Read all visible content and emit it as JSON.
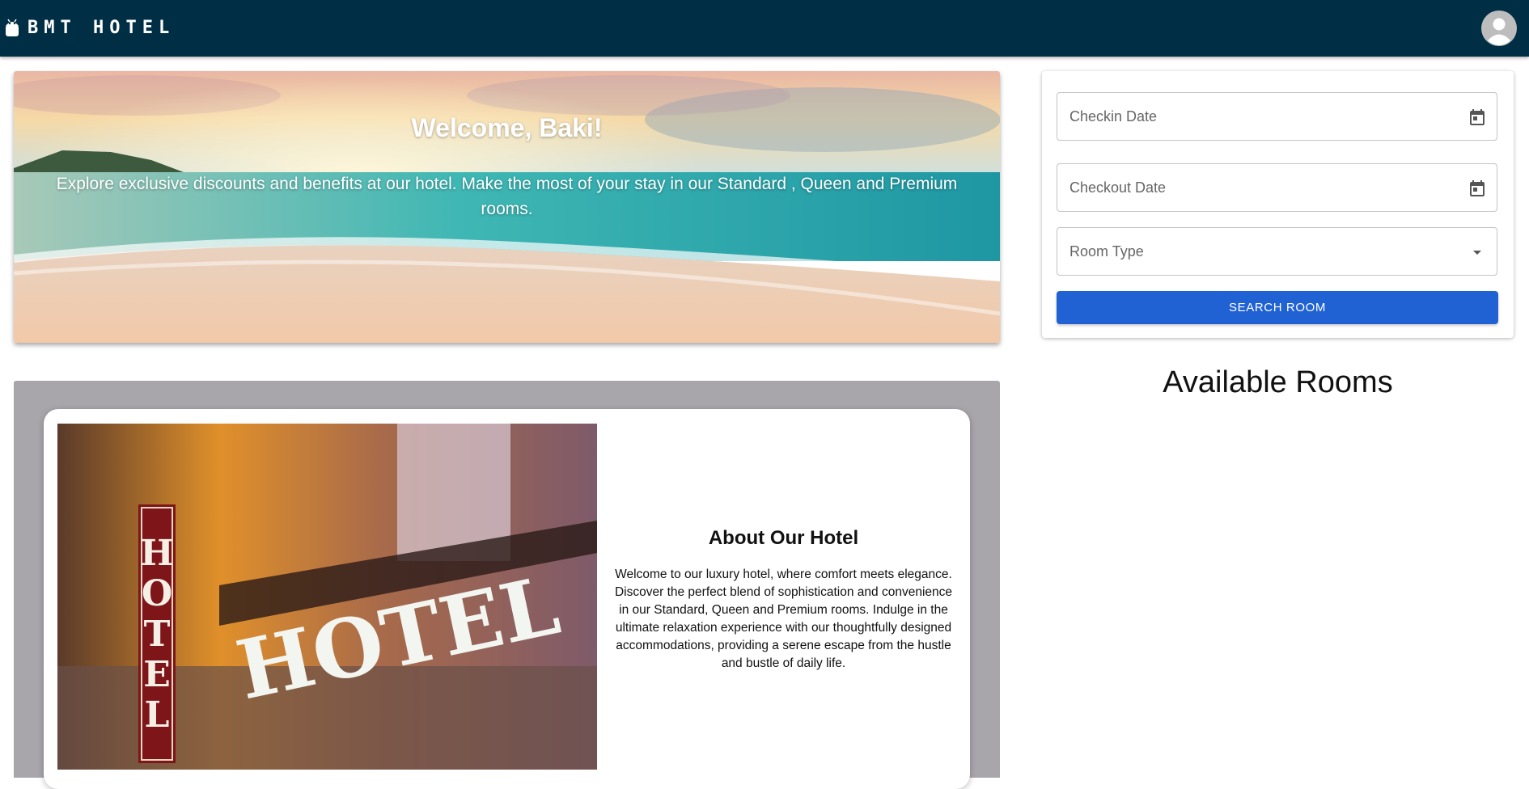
{
  "appbar": {
    "brand": "BMT HOTEL",
    "brand_icon": "android-icon",
    "avatar_icon": "account-circle-icon",
    "background": "#002e45"
  },
  "hero": {
    "title": "Welcome, Baki!",
    "subtitle": "Explore exclusive discounts and benefits at our hotel. Make the most of your stay in our Standard , Queen and Premium rooms."
  },
  "about": {
    "title": "About Our Hotel",
    "text": "Welcome to our luxury hotel, where comfort meets elegance. Discover the perfect blend of sophistication and convenience in our Standard, Queen and Premium rooms. Indulge in the ultimate relaxation experience with our thoughtfully designed accommodations, providing a serene escape from the hustle and bustle of daily life.",
    "image_sign_vertical": "HOTEL",
    "image_sign_horizontal": "HOTEL"
  },
  "search": {
    "checkin_placeholder": "Checkin Date",
    "checkout_placeholder": "Checkout Date",
    "room_type_placeholder": "Room Type",
    "button_label": "SEARCH ROOM",
    "button_color": "#2062d4",
    "calendar_icon": "calendar-icon",
    "dropdown_icon": "arrow-drop-down-icon"
  },
  "rooms": {
    "heading": "Available Rooms"
  }
}
